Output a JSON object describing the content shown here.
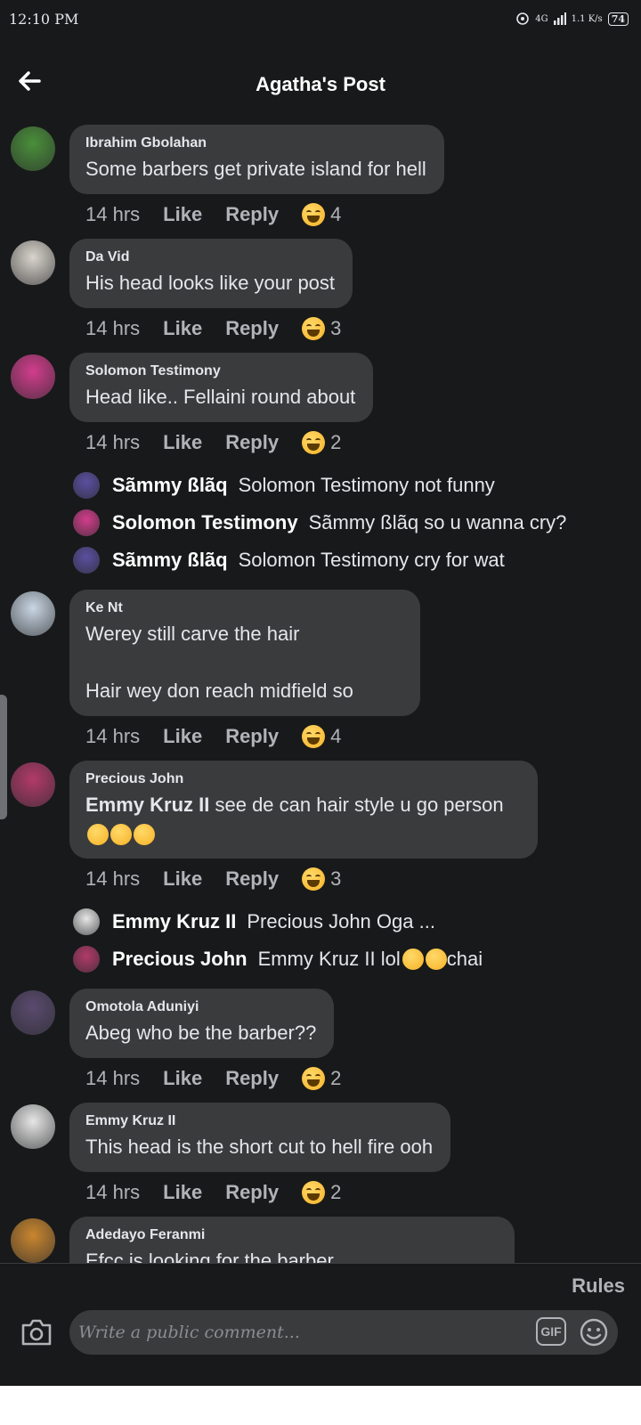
{
  "status_bar": {
    "time": "12:10 PM",
    "network": "4G",
    "speed": "1.1 K/s",
    "battery": "74"
  },
  "header": {
    "title": "Agatha's Post"
  },
  "comments": [
    {
      "author": "Ibrahim Gbolahan",
      "text": "Some barbers get private island for hell",
      "time": "14 hrs",
      "like": "Like",
      "reply": "Reply",
      "reactions": "4",
      "avatar_color": "#4a8f3a"
    },
    {
      "author": "Da Vid",
      "text": "His head looks like your post",
      "time": "14 hrs",
      "like": "Like",
      "reply": "Reply",
      "reactions": "3",
      "avatar_color": "#d9d4cc"
    },
    {
      "author": "Solomon Testimony",
      "text": "Head like..  Fellaini round about",
      "time": "14 hrs",
      "like": "Like",
      "reply": "Reply",
      "reactions": "2",
      "avatar_color": "#d23d8c"
    },
    {
      "author": "Ke Nt",
      "text": "Werey still carve the hair\n\nHair wey don reach midfield so",
      "time": "14 hrs",
      "like": "Like",
      "reply": "Reply",
      "reactions": "4",
      "avatar_color": "#c9d6e3"
    },
    {
      "author": "Precious John",
      "mention": "Emmy Kruz II",
      "text": " see de can hair style u go person",
      "time": "14 hrs",
      "like": "Like",
      "reply": "Reply",
      "reactions": "3",
      "avatar_color": "#b23a6a"
    },
    {
      "author": "Omotola Aduniyi",
      "text": "Abeg who be the barber??",
      "time": "14 hrs",
      "like": "Like",
      "reply": "Reply",
      "reactions": "2",
      "avatar_color": "#5a4a6e"
    },
    {
      "author": "Emmy Kruz II",
      "text": "This head is the short cut to hell fire ooh",
      "time": "14 hrs",
      "like": "Like",
      "reply": "Reply",
      "reactions": "2",
      "avatar_color": "#e6e6e6"
    },
    {
      "author": "Adedayo Feranmi",
      "text": "Efcc is looking for the barber",
      "avatar_color": "#c9862e"
    }
  ],
  "replies_solomon": [
    {
      "name": "Sãmmy ßlãq",
      "text": "Solomon Testimony  not funny",
      "avatar_color": "#5a4fa0"
    },
    {
      "name": "Solomon Testimony",
      "text": "Sãmmy ßlãq so u wanna cry?",
      "avatar_color": "#d23d8c"
    },
    {
      "name": "Sãmmy ßlãq",
      "text": "Solomon Testimony cry for wat",
      "avatar_color": "#5a4fa0"
    }
  ],
  "replies_precious": [
    {
      "name": "Emmy Kruz II",
      "text": "Precious John Oga ...",
      "avatar_color": "#e6e6e6"
    },
    {
      "name": "Precious John",
      "text": "Emmy Kruz II lol ",
      "text_suffix": "chai",
      "avatar_color": "#b23a6a"
    }
  ],
  "footer": {
    "rules": "Rules",
    "input_placeholder": "Write a public comment...",
    "gif_label": "GIF"
  }
}
